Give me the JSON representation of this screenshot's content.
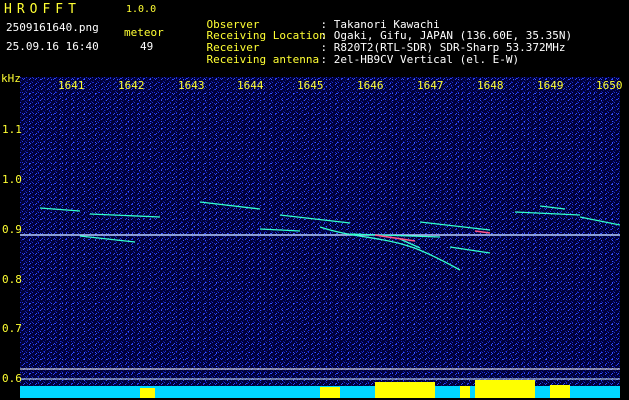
{
  "app": {
    "title": "HROFFT",
    "version": "1.0.0"
  },
  "capture": {
    "file": "2509161640.png",
    "datetime": "25.09.16 16:40",
    "meteor_label": "meteor",
    "meteor_count": "49"
  },
  "info": [
    {
      "label": "Observer",
      "value": ": Takanori Kawachi"
    },
    {
      "label": "Receiving Location",
      "value": ": Ogaki, Gifu, JAPAN (136.60E, 35.35N)"
    },
    {
      "label": "Receiver",
      "value": ": R820T2(RTL-SDR) SDR-Sharp 53.372MHz"
    },
    {
      "label": "Receiving antenna",
      "value": ": 2el-HB9CV Vertical (el. E-W)"
    }
  ],
  "axis": {
    "unit": "kHz",
    "x_ticks": [
      "1641",
      "1642",
      "1643",
      "1644",
      "1645",
      "1646",
      "1647",
      "1648",
      "1649",
      "1650"
    ],
    "y_ticks": [
      "1.1",
      "1.0",
      "0.9",
      "0.8",
      "0.7",
      "0.6"
    ]
  },
  "colors": {
    "label": "#ffff33",
    "background": "#000010",
    "trace": "#33ffcc"
  }
}
